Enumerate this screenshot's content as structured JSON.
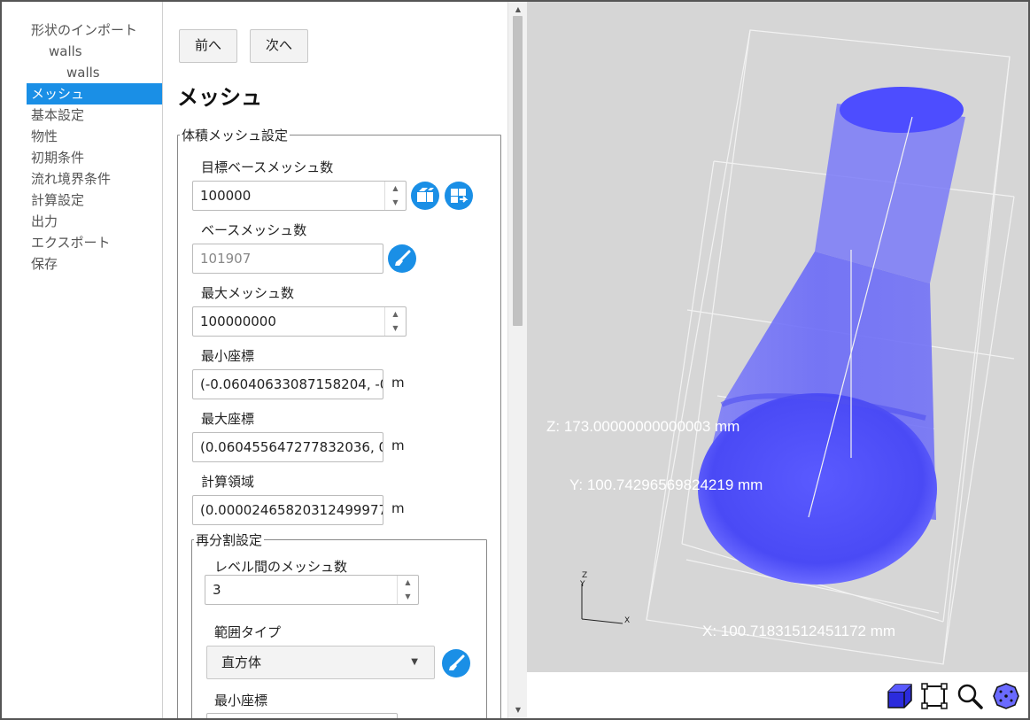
{
  "sidebar": {
    "items": [
      {
        "label": "形状のインポート"
      },
      {
        "label": "walls"
      },
      {
        "label": "walls"
      },
      {
        "label": "メッシュ"
      },
      {
        "label": "基本設定"
      },
      {
        "label": "物性"
      },
      {
        "label": "初期条件"
      },
      {
        "label": "流れ境界条件"
      },
      {
        "label": "計算設定"
      },
      {
        "label": "出力"
      },
      {
        "label": "エクスポート"
      },
      {
        "label": "保存"
      }
    ],
    "active_index": 3,
    "active_color": "#1a8fe6"
  },
  "nav": {
    "prev_label": "前へ",
    "next_label": "次へ"
  },
  "page_title": "メッシュ",
  "volume_mesh": {
    "legend": "体積メッシュ設定",
    "target_base_mesh_count": {
      "label": "目標ベースメッシュ数",
      "value": "100000"
    },
    "base_mesh_count": {
      "label": "ベースメッシュ数",
      "value": "101907"
    },
    "max_mesh_count": {
      "label": "最大メッシュ数",
      "value": "100000000"
    },
    "min_coord": {
      "label": "最小座標",
      "value": "(-0.06040633087158204, -0.",
      "unit": "m"
    },
    "max_coord": {
      "label": "最大座標",
      "value": "(0.060455647277832036, 0.",
      "unit": "m"
    },
    "calc_domain": {
      "label": "計算領域",
      "value": "(0.00002465820312499977",
      "unit": "m"
    }
  },
  "refinement": {
    "legend": "再分割設定",
    "mesh_between_levels": {
      "label": "レベル間のメッシュ数",
      "value": "3"
    },
    "range_type": {
      "label": "範囲タイプ",
      "selected": "直方体"
    },
    "min_coord": {
      "label": "最小座標"
    }
  },
  "viewer": {
    "z_label": "Z: 173.00000000000003 mm",
    "y_label": "Y: 100.74296569824219 mm",
    "x_label": "X: 100.71831512451172 mm",
    "axis_z": "Z",
    "axis_y": "Y",
    "axis_x": "X",
    "background": "#d6d6d6",
    "model_color": "#5555ff"
  },
  "toolbar": {
    "icons": [
      "cube-view-icon",
      "fit-frame-icon",
      "zoom-icon",
      "rotate-sphere-icon"
    ]
  }
}
